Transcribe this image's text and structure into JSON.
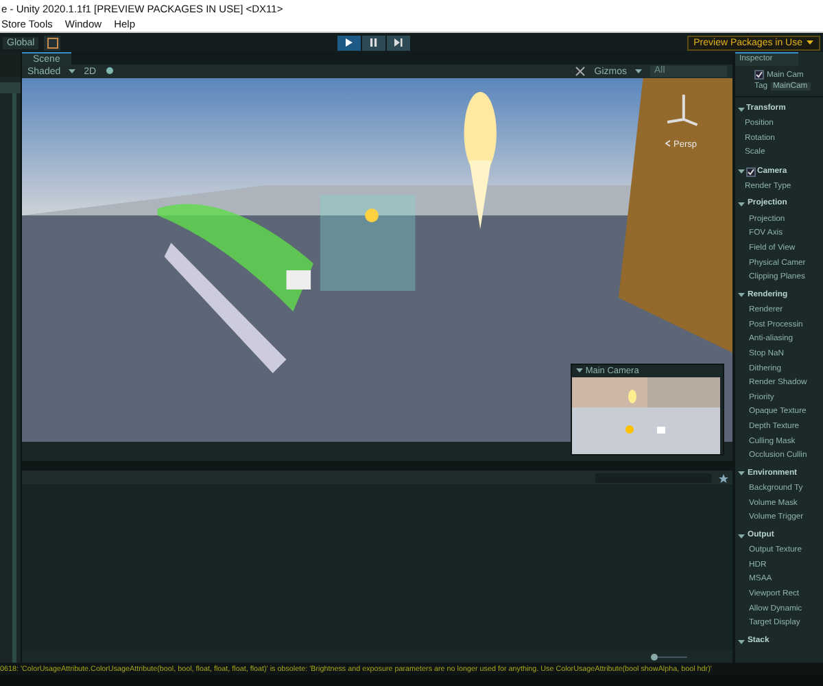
{
  "window": {
    "title": "e - Unity 2020.1.1f1 [PREVIEW PACKAGES IN USE] <DX11>"
  },
  "menu": [
    "Store Tools",
    "Window",
    "Help"
  ],
  "toolbar": {
    "layers": "Global",
    "controls": [
      {
        "kind": "play",
        "selected": true
      },
      {
        "kind": "pause",
        "selected": false
      },
      {
        "kind": "step",
        "selected": false
      }
    ],
    "preview_button": "Preview Packages in Use"
  },
  "scene": {
    "tab": "Scene",
    "shading": "Shaded",
    "mode_2d": "2D",
    "gizmos": "Gizmos",
    "search": {
      "placeholder": "All"
    },
    "projection_label": "Persp",
    "camera_preview": {
      "title": "Main Camera"
    }
  },
  "inspector": {
    "tab": "Inspector",
    "object": {
      "name": "Main Cam",
      "active": true
    },
    "tag_label": "Tag",
    "tag": "MainCam",
    "components": [
      {
        "title": "Transform",
        "fields": [
          "Position",
          "Rotation",
          "Scale"
        ]
      },
      {
        "title": "Camera",
        "enabled": true,
        "fields": [
          "Render Type"
        ],
        "groups": [
          {
            "title": "Projection",
            "fields": [
              "Projection",
              "FOV Axis",
              "Field of View",
              "Physical Camer",
              "Clipping Planes"
            ]
          },
          {
            "title": "Rendering",
            "fields": [
              "Renderer",
              "Post Processin",
              "Anti-aliasing",
              "Stop NaN",
              "Dithering",
              "Render Shadow",
              "Priority",
              "Opaque Texture",
              "Depth Texture",
              "Culling Mask",
              "Occlusion Cullin"
            ]
          },
          {
            "title": "Environment",
            "fields": [
              "Background Ty",
              "Volume Mask",
              "Volume Trigger"
            ]
          },
          {
            "title": "Output",
            "fields": [
              "Output Texture",
              "HDR",
              "MSAA",
              "Viewport Rect",
              "Allow Dynamic",
              "Target Display"
            ]
          },
          {
            "title": "Stack"
          }
        ]
      }
    ]
  },
  "console": {
    "zoom": {
      "level": 0
    }
  },
  "status_bar": {
    "message": "0618: 'ColorUsageAttribute.ColorUsageAttribute(bool, bool, float, float, float, float)' is obsolete: 'Brightness and exposure parameters are no longer used for anything. Use ColorUsageAttribute(bool showAlpha, bool hdr)'"
  }
}
